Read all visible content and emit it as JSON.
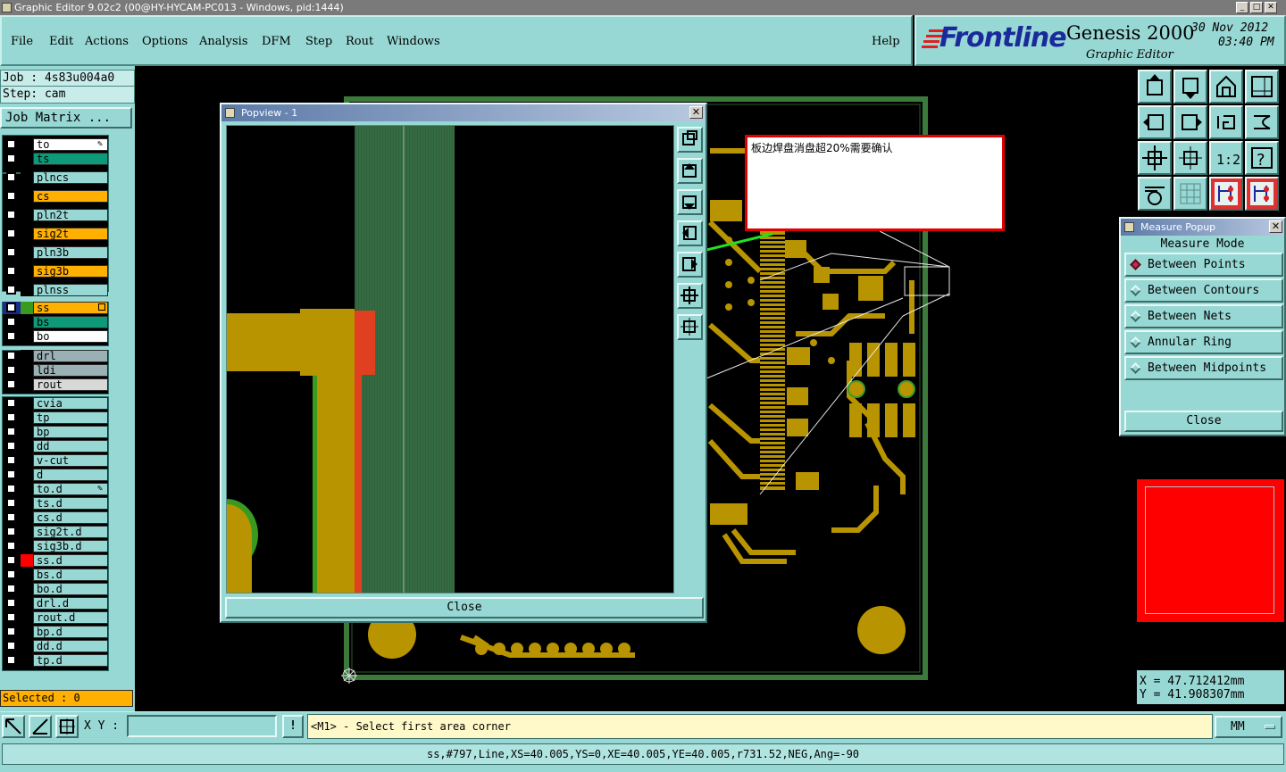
{
  "window": {
    "title": "Graphic Editor 9.02c2 (00@HY-HYCAM-PC013 - Windows, pid:1444)"
  },
  "menu": {
    "items": [
      "File",
      "Edit",
      "Actions",
      "Options",
      "Analysis",
      "DFM",
      "Step",
      "Rout",
      "Windows"
    ],
    "help": "Help"
  },
  "brand": {
    "logo": "Frontline",
    "product": "Genesis 2000",
    "subtitle": "Graphic Editor",
    "date": "30 Nov 2012",
    "time": "03:40 PM"
  },
  "job": {
    "job_label": "Job : 4s83u004a0",
    "step_label": "Step: cam",
    "matrix_button": "Job Matrix ..."
  },
  "layers": [
    {
      "name": "to",
      "color": "#ffffff",
      "swatch": "#000000",
      "flag": "edit"
    },
    {
      "name": "ts",
      "color": "#0e9a78",
      "swatch": "#000000"
    },
    {
      "name": "plncs",
      "color": "#98d8d4",
      "swatch": "#000000"
    },
    {
      "name": "cs",
      "color": "#ffb000",
      "swatch": "#000000"
    },
    {
      "name": "pln2t",
      "color": "#98d8d4",
      "swatch": "#000000"
    },
    {
      "name": "sig2t",
      "color": "#ffb000",
      "swatch": "#000000"
    },
    {
      "name": "pln3b",
      "color": "#98d8d4",
      "swatch": "#000000"
    },
    {
      "name": "sig3b",
      "color": "#ffb000",
      "swatch": "#000000"
    },
    {
      "name": "plnss",
      "color": "#98d8d4",
      "swatch": "#000000"
    },
    {
      "name": "ss",
      "color": "#ffb000",
      "swatch": "#3a9a20",
      "active": true,
      "flag": "grid"
    },
    {
      "name": "bs",
      "color": "#0e9a78",
      "swatch": "#000000"
    },
    {
      "name": "bo",
      "color": "#ffffff",
      "swatch": "#000000"
    },
    {
      "name": "drl",
      "color": "#9ab0b4",
      "swatch": "#000000"
    },
    {
      "name": "ldi",
      "color": "#9ab0b4",
      "swatch": "#000000"
    },
    {
      "name": "rout",
      "color": "#d8d8d8",
      "swatch": "#000000"
    },
    {
      "name": "cvia",
      "color": "#98d8d4",
      "swatch": "#000000"
    },
    {
      "name": "tp",
      "color": "#98d8d4",
      "swatch": "#000000"
    },
    {
      "name": "bp",
      "color": "#98d8d4",
      "swatch": "#000000"
    },
    {
      "name": "dd",
      "color": "#98d8d4",
      "swatch": "#000000"
    },
    {
      "name": "v-cut",
      "color": "#98d8d4",
      "swatch": "#000000"
    },
    {
      "name": "d",
      "color": "#98d8d4",
      "swatch": "#000000"
    },
    {
      "name": "to.d",
      "color": "#98d8d4",
      "swatch": "#000000",
      "flag": "edit"
    },
    {
      "name": "ts.d",
      "color": "#98d8d4",
      "swatch": "#000000"
    },
    {
      "name": "cs.d",
      "color": "#98d8d4",
      "swatch": "#000000"
    },
    {
      "name": "sig2t.d",
      "color": "#98d8d4",
      "swatch": "#000000"
    },
    {
      "name": "sig3b.d",
      "color": "#98d8d4",
      "swatch": "#000000"
    },
    {
      "name": "ss.d",
      "color": "#98d8d4",
      "swatch": "#ff0000"
    },
    {
      "name": "bs.d",
      "color": "#98d8d4",
      "swatch": "#000000"
    },
    {
      "name": "bo.d",
      "color": "#98d8d4",
      "swatch": "#000000"
    },
    {
      "name": "drl.d",
      "color": "#98d8d4",
      "swatch": "#000000"
    },
    {
      "name": "rout.d",
      "color": "#98d8d4",
      "swatch": "#000000"
    },
    {
      "name": "bp.d",
      "color": "#98d8d4",
      "swatch": "#000000"
    },
    {
      "name": "dd.d",
      "color": "#98d8d4",
      "swatch": "#000000"
    },
    {
      "name": "tp.d",
      "color": "#98d8d4",
      "swatch": "#000000"
    }
  ],
  "selected": "Selected : 0",
  "popview": {
    "title": "Popview - 1",
    "close_label": "Close"
  },
  "annotation": {
    "text": "板边焊盘消盘超20%需要确认"
  },
  "measure": {
    "title": "Measure Popup",
    "mode_label": "Measure Mode",
    "options": [
      {
        "label": "Between Points",
        "selected": true
      },
      {
        "label": "Between Contours",
        "selected": false
      },
      {
        "label": "Between Nets",
        "selected": false
      },
      {
        "label": "Annular Ring",
        "selected": false
      },
      {
        "label": "Between Midpoints",
        "selected": false
      }
    ],
    "close_label": "Close"
  },
  "coords": {
    "x_label": "X = 47.712412mm",
    "y_label": "Y = 41.908307mm"
  },
  "bottom": {
    "xy_label": "X Y :",
    "xy_value": "",
    "prompt": "<M1> - Select first area corner",
    "units": "MM",
    "status": "ss,#797,Line,XS=40.005,YS=0,XE=40.005,YE=40.005,r731.52,NEG,Ang=-90"
  },
  "colors": {
    "panel": "#98d8d4",
    "copper": "#b89400",
    "solder_mask": "#3a6a40",
    "arrow": "#22e022",
    "annotation_border": "#e00000",
    "title_gray": "#7a7a7a"
  }
}
